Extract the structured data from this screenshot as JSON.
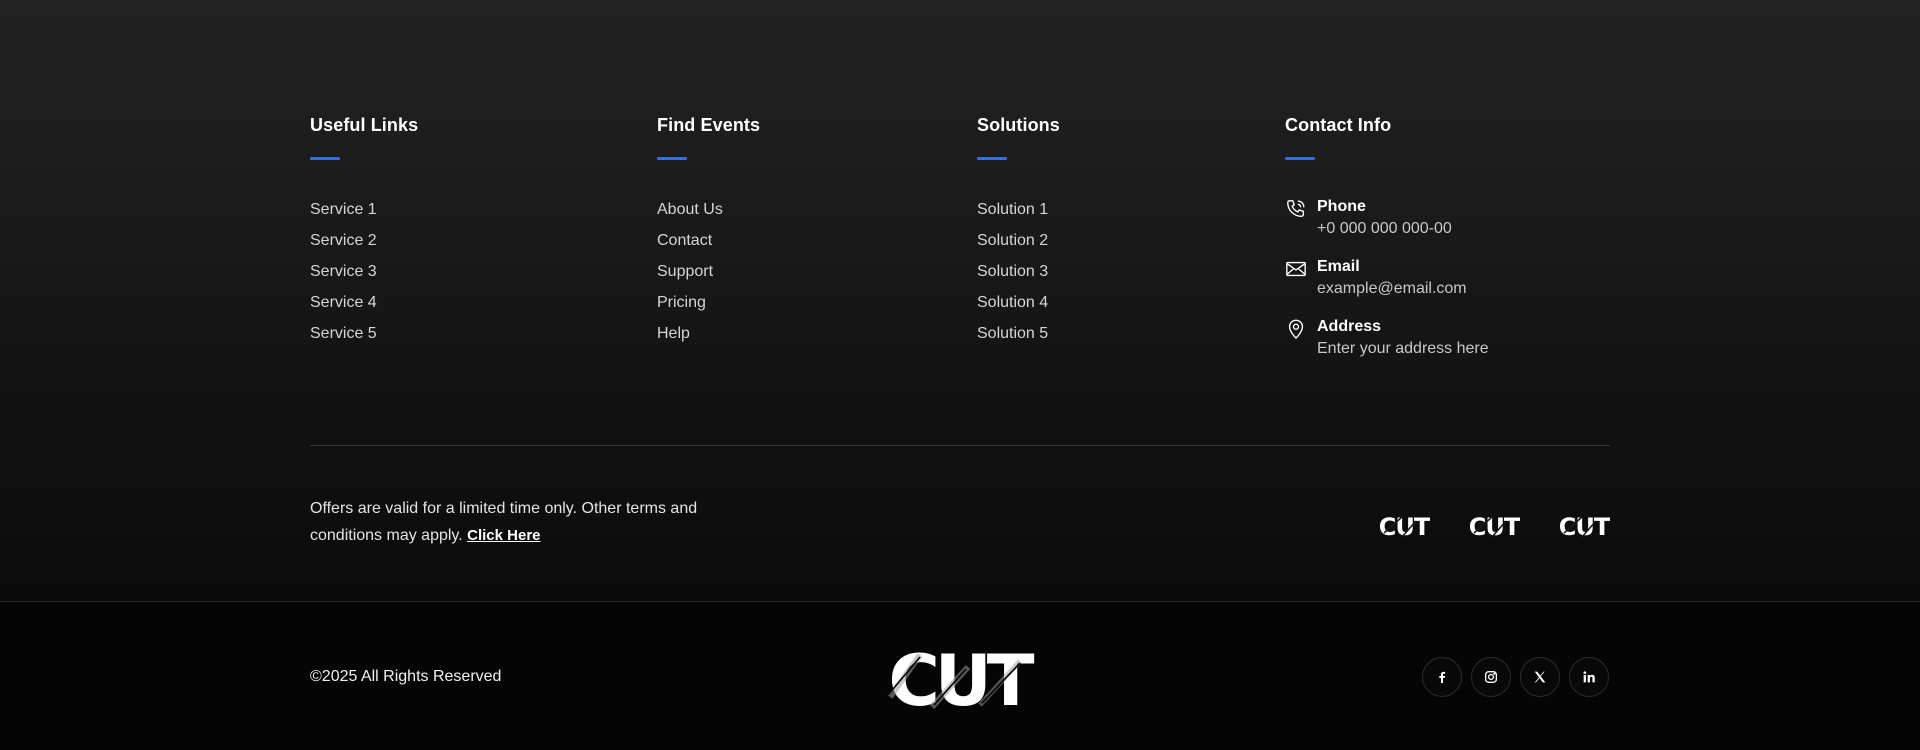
{
  "columns": {
    "useful_links": {
      "title": "Useful Links",
      "items": [
        "Service 1",
        "Service 2",
        "Service 3",
        "Service 4",
        "Service 5"
      ]
    },
    "find_events": {
      "title": "Find Events",
      "items": [
        "About Us",
        "Contact",
        "Support",
        "Pricing",
        "Help"
      ]
    },
    "solutions": {
      "title": "Solutions",
      "items": [
        "Solution 1",
        "Solution 2",
        "Solution 3",
        "Solution 4",
        "Solution 5"
      ]
    },
    "contact": {
      "title": "Contact Info",
      "items": [
        {
          "icon": "phone-icon",
          "label": "Phone",
          "value": "+0 000 000 000-00"
        },
        {
          "icon": "envelope-icon",
          "label": "Email",
          "value": "example@email.com"
        },
        {
          "icon": "map-pin-icon",
          "label": "Address",
          "value": "Enter your address here"
        }
      ]
    }
  },
  "offer": {
    "text": "Offers are valid for a limited time only. Other terms and conditions may apply.",
    "link_label": "Click Here"
  },
  "partner_logos": [
    "CUT",
    "CUT",
    "CUT"
  ],
  "bottom": {
    "copyright": "©2025 All Rights Reserved",
    "logo_text": "CUT",
    "socials": [
      "facebook-icon",
      "instagram-icon",
      "x-twitter-icon",
      "linkedin-icon"
    ]
  },
  "colors": {
    "accent": "#2f6fe0",
    "background_top": "#222223",
    "background_bottom": "#050505",
    "text_muted": "#d5d5d5"
  }
}
